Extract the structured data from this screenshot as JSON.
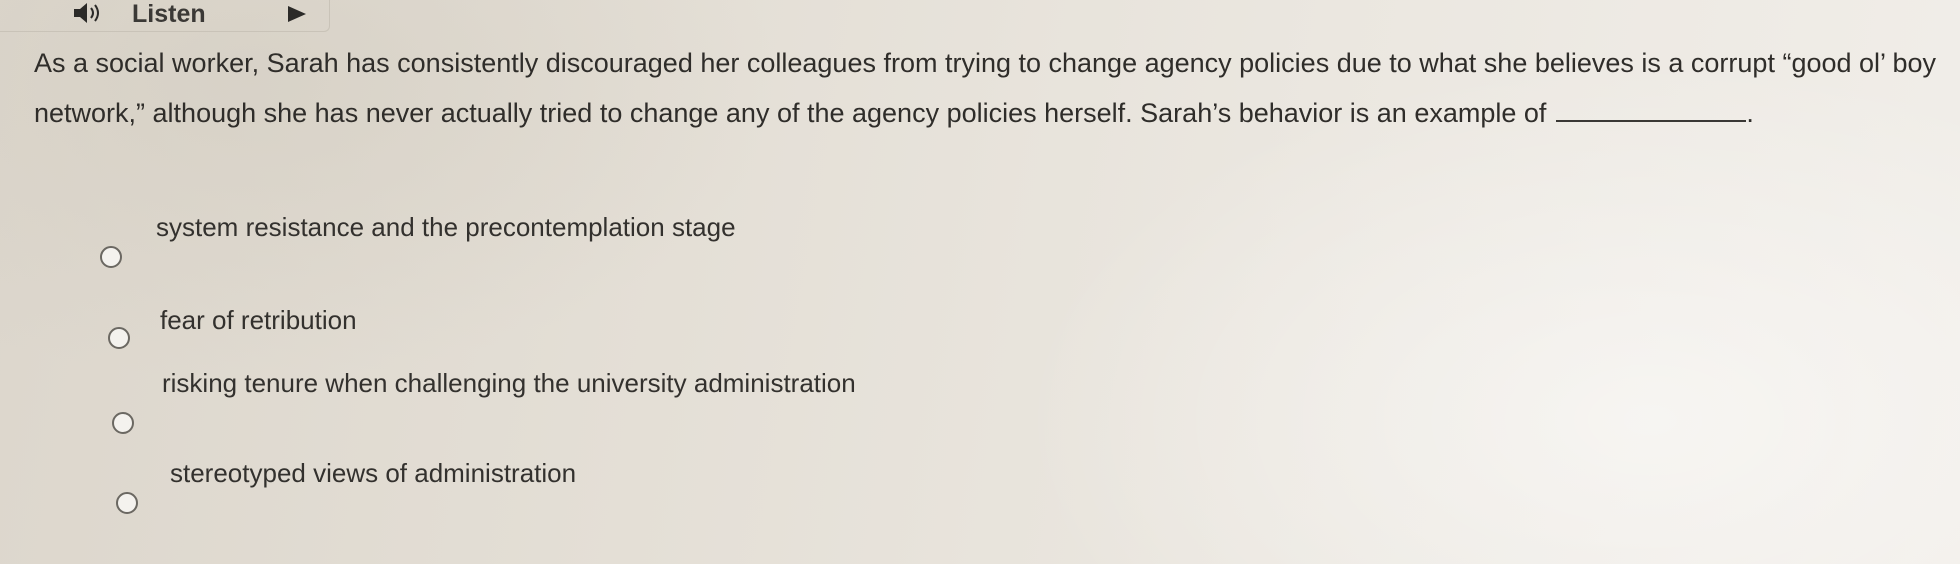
{
  "toolbar": {
    "listen_label": "Listen",
    "speaker_icon": "speaker-icon",
    "play_icon": "play-icon"
  },
  "question": {
    "text": "As a social worker, Sarah has consistently discouraged her colleagues from trying to change agency policies due to what she believes is a corrupt “good ol’ boy network,” although she has never actually tried to change any of the agency policies herself. Sarah’s behavior is an example of",
    "blank_suffix": "."
  },
  "options": [
    {
      "label": "system resistance and the precontemplation stage",
      "selected": false
    },
    {
      "label": "fear of retribution",
      "selected": false
    },
    {
      "label": "risking tenure when challenging the university administration",
      "selected": false
    },
    {
      "label": "stereotyped views of administration",
      "selected": false
    }
  ],
  "colors": {
    "text": "#2f2d2a",
    "icon": "#2b2a28",
    "radio_border": "#6b6862"
  }
}
